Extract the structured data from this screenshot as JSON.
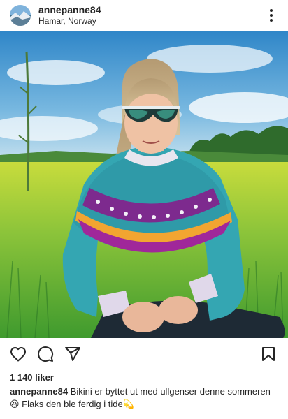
{
  "post": {
    "username": "annepanne84",
    "location": "Hamar, Norway",
    "likes": "1 140 liker",
    "caption": {
      "username": "annepanne84",
      "text": "Bikini er byttet ut med ullgenser denne sommeren 😆 Flaks den ble ferdig i tide💫"
    }
  },
  "icons": {
    "more": "more-options-icon",
    "like": "heart-icon",
    "comment": "comment-icon",
    "share": "send-icon",
    "save": "bookmark-icon"
  },
  "colors": {
    "text": "#262626",
    "background": "#ffffff"
  }
}
